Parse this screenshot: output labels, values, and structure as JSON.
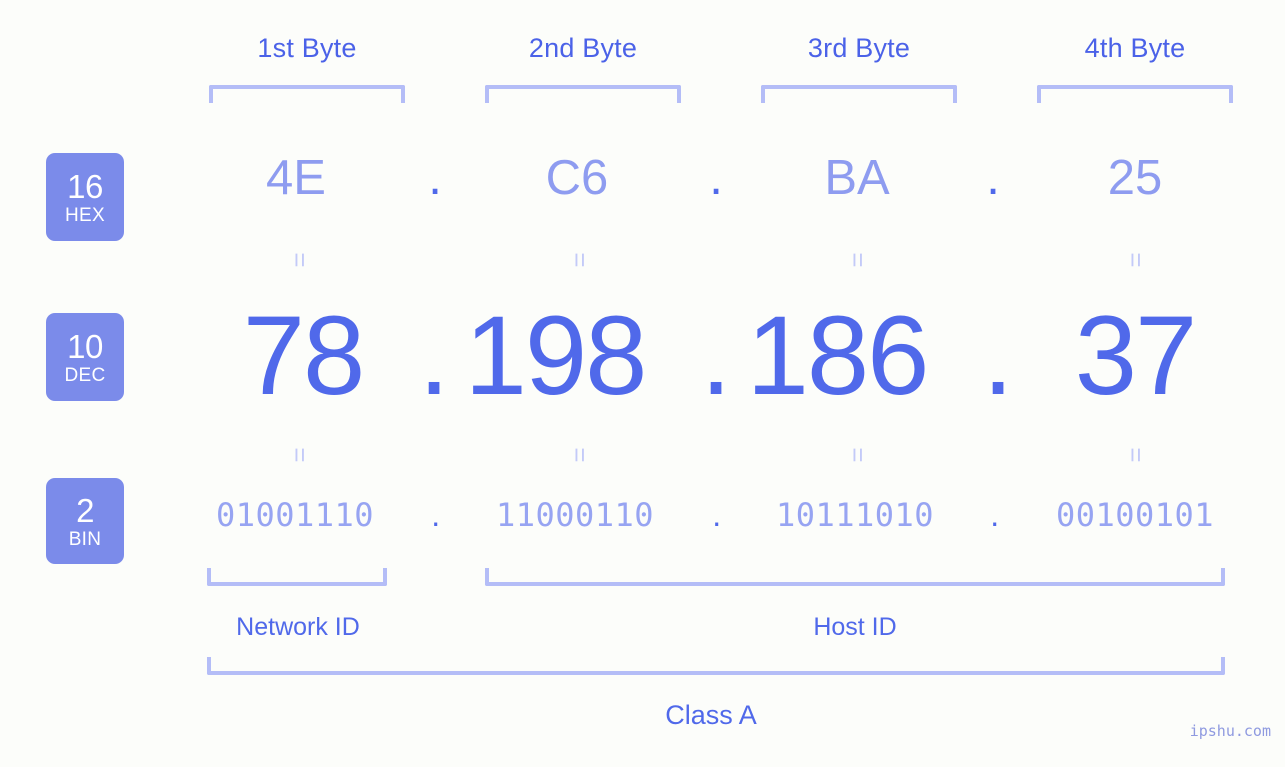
{
  "background_color": "#fcfdfa",
  "accent_colors": {
    "strong_blue": "#5069ea",
    "badge_blue": "#7b8bea",
    "light_blue": "#8e9cf0",
    "bracket_lavender": "#b4bdf7",
    "equals_lavender": "#c3caf8"
  },
  "byte_headers": [
    {
      "label": "1st Byte"
    },
    {
      "label": "2nd Byte"
    },
    {
      "label": "3rd Byte"
    },
    {
      "label": "4th Byte"
    }
  ],
  "bases": [
    {
      "number": "16",
      "name": "HEX"
    },
    {
      "number": "10",
      "name": "DEC"
    },
    {
      "number": "2",
      "name": "BIN"
    }
  ],
  "rows": {
    "hex": {
      "values": [
        "4E",
        "C6",
        "BA",
        "25"
      ],
      "separator": "."
    },
    "dec": {
      "values": [
        "78",
        "198",
        "186",
        "37"
      ],
      "separator": "."
    },
    "bin": {
      "values": [
        "01001110",
        "11000110",
        "10111010",
        "00100101"
      ],
      "separator": "."
    }
  },
  "equals_mark": "=",
  "segments": {
    "network_id": "Network ID",
    "host_id": "Host ID"
  },
  "class_label": "Class A",
  "watermark": "ipshu.com"
}
